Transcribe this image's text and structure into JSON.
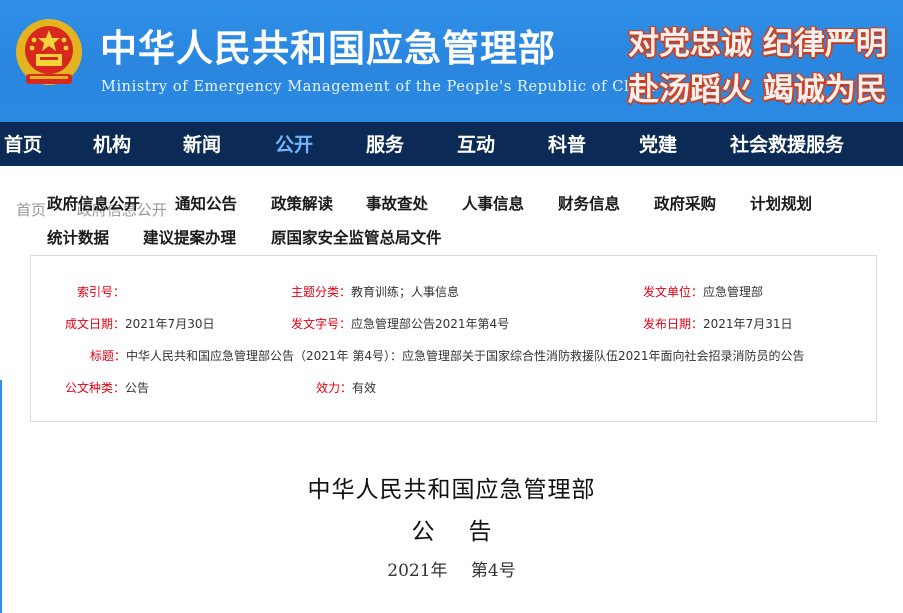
{
  "header": {
    "title": "中华人民共和国应急管理部",
    "subtitle": "Ministry of Emergency Management of the People's Republic of China",
    "slogan_line1": "对党忠诚 纪律严明",
    "slogan_line2": "赴汤蹈火 竭诚为民",
    "emblem_icon": "national-emblem-icon"
  },
  "main_nav": {
    "items": [
      "首页",
      "机构",
      "新闻",
      "公开",
      "服务",
      "互动",
      "科普",
      "党建",
      "社会救援服务"
    ],
    "active": "公开"
  },
  "sub_nav": {
    "items": [
      "政府信息公开",
      "通知公告",
      "政策解读",
      "事故查处",
      "人事信息",
      "财务信息",
      "政府采购",
      "计划规划",
      "统计数据",
      "建议提案办理",
      "原国家安全监管总局文件"
    ]
  },
  "breadcrumb": {
    "items": [
      "首页",
      "政府信息公开"
    ]
  },
  "meta": {
    "index_label": "索引号：",
    "index_value": "",
    "category_label": "主题分类：",
    "category_value": "教育训练；人事信息",
    "issuer_label": "发文单位：",
    "issuer_value": "应急管理部",
    "created_label": "成文日期：",
    "created_value": "2021年7月30日",
    "docno_label": "发文字号：",
    "docno_value": "应急管理部公告2021年第4号",
    "published_label": "发布日期：",
    "published_value": "2021年7月31日",
    "title_label": "标题：",
    "title_value": "中华人民共和国应急管理部公告（2021年 第4号）：应急管理部关于国家综合性消防救援队伍2021年面向社会招录消防员的公告",
    "doctype_label": "公文种类：",
    "doctype_value": "公告",
    "validity_label": "效力：",
    "validity_value": "有效"
  },
  "document": {
    "issuer": "中华人民共和国应急管理部",
    "type": "公告",
    "number": "2021年 第4号"
  },
  "colors": {
    "banner": "#2f8fe8",
    "nav_bg": "#0b2a55",
    "nav_active": "#6fb6ff",
    "label_red": "#e60012",
    "slogan_outline": "#d2401f"
  }
}
